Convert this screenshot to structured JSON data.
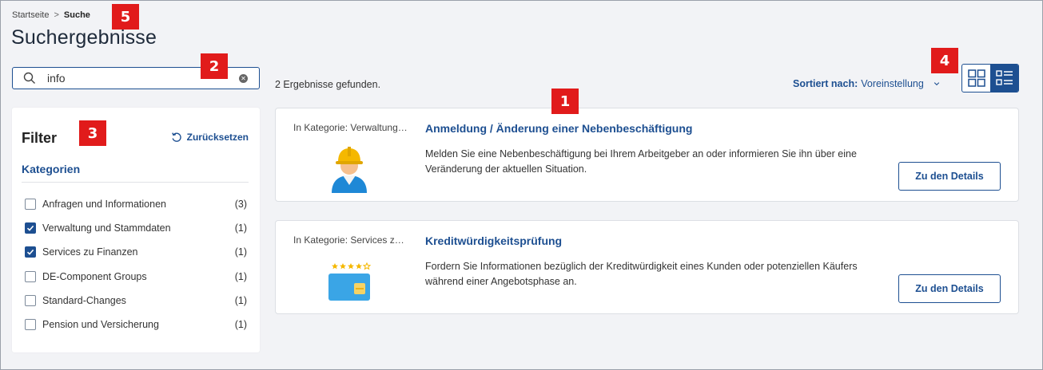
{
  "breadcrumb": {
    "home": "Startseite",
    "separator": ">",
    "current": "Suche"
  },
  "page_title": "Suchergebnisse",
  "search": {
    "value": "info",
    "placeholder": ""
  },
  "markers": {
    "m1": "1",
    "m2": "2",
    "m3": "3",
    "m4": "4",
    "m5": "5"
  },
  "filter": {
    "title": "Filter",
    "reset_label": "Zurücksetzen",
    "categories_heading": "Kategorien",
    "categories": [
      {
        "label": "Anfragen und Informationen",
        "count": "(3)",
        "checked": false
      },
      {
        "label": "Verwaltung und Stammdaten",
        "count": "(1)",
        "checked": true
      },
      {
        "label": "Services zu Finanzen",
        "count": "(1)",
        "checked": true
      },
      {
        "label": "DE-Component Groups",
        "count": "(1)",
        "checked": false
      },
      {
        "label": "Standard-Changes",
        "count": "(1)",
        "checked": false
      },
      {
        "label": "Pension und Versicherung",
        "count": "(1)",
        "checked": false
      }
    ]
  },
  "results": {
    "count_text": "2 Ergebnisse gefunden.",
    "sort_label": "Sortiert nach:",
    "sort_value": "Voreinstellung",
    "items": [
      {
        "category": "In Kategorie: Verwaltung und Stammdaten",
        "title": "Anmeldung / Änderung einer Nebenbeschäftigung",
        "description": "Melden Sie eine Nebenbeschäftigung bei Ihrem Arbeitgeber an oder informieren Sie ihn über eine Veränderung der aktuellen Situation.",
        "button": "Zu den Details",
        "icon": "worker-helmet-icon"
      },
      {
        "category": "In Kategorie: Services zu Finanzen",
        "title": "Kreditwürdigkeitsprüfung",
        "description": "Fordern Sie Informationen bezüglich der Kreditwürdigkeit eines Kunden oder potenziellen Käufers während einer Angebotsphase an.",
        "button": "Zu den Details",
        "icon": "credit-card-icon"
      }
    ]
  },
  "colors": {
    "accent": "#1d4f91",
    "marker": "#e11b1b",
    "background": "#f2f3f6"
  }
}
